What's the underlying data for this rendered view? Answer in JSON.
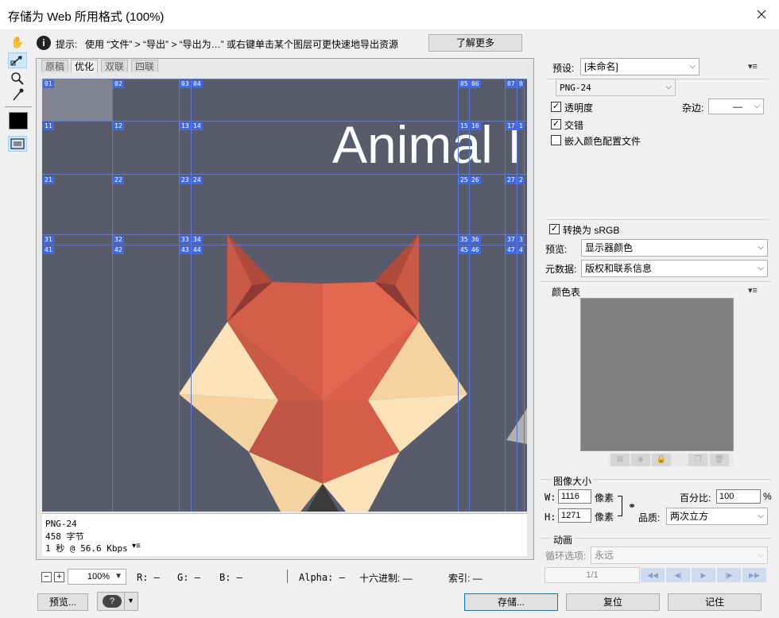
{
  "window": {
    "title": "存储为 Web 所用格式 (100%)",
    "close_icon": "close-icon"
  },
  "tip_bar": {
    "prefix": "提示:",
    "text": "使用 “文件” > “导出” > “导出为…” 或右键单击某个图层可更快速地导出资源",
    "learn_more": "了解更多"
  },
  "tabs": [
    "原稿",
    "优化",
    "双联",
    "四联"
  ],
  "active_tab": "优化",
  "preview": {
    "background": "#585b6a",
    "headline": "Animal I",
    "slice_labels_row1": [
      "01",
      "02",
      "03",
      "04",
      "05",
      "06",
      "07",
      "0"
    ],
    "slice_labels_row2": [
      "11",
      "12",
      "13",
      "14",
      "15",
      "16",
      "17",
      "1"
    ],
    "slice_labels_row3": [
      "21",
      "22",
      "23",
      "24",
      "25",
      "26",
      "27",
      "2"
    ],
    "slice_labels_row4": [
      "31",
      "32",
      "33",
      "34",
      "35",
      "36",
      "37",
      "3"
    ],
    "slice_labels_row5": [
      "41",
      "42",
      "43",
      "44",
      "45",
      "46",
      "47",
      "4"
    ]
  },
  "optim_info": {
    "format": "PNG-24",
    "size": "458 字节",
    "speed": "1 秒 @ 56.6 Kbps"
  },
  "status_bar": {
    "zoom": "100%",
    "r": "R: —",
    "g": "G: —",
    "b": "B: —",
    "alpha": "Alpha: —",
    "hex": "十六进制: —",
    "index": "索引: —"
  },
  "bottom_buttons": {
    "preview": "预览...",
    "save": "存储...",
    "reset": "复位",
    "remember": "记住"
  },
  "settings": {
    "preset_label": "预设:",
    "preset_value": "[未命名]",
    "format_value": "PNG-24",
    "transparency_label": "透明度",
    "transparency_checked": true,
    "matte_label": "杂边:",
    "matte_value": "—",
    "interlaced_label": "交错",
    "interlaced_checked": true,
    "embed_profile_label": "嵌入颜色配置文件",
    "embed_profile_checked": false,
    "convert_srgb_label": "转换为 sRGB",
    "convert_srgb_checked": true,
    "preview_label": "预览:",
    "preview_value": "显示器颜色",
    "metadata_label": "元数据:",
    "metadata_value": "版权和联系信息"
  },
  "color_table": {
    "title": "颜色表",
    "swatch_color": "#808080"
  },
  "image_size": {
    "title": "图像大小",
    "w_label": "W:",
    "w_value": "1116",
    "h_label": "H:",
    "h_value": "1271",
    "unit": "像素",
    "percent_label": "百分比:",
    "percent_value": "100",
    "percent_unit": "%",
    "quality_label": "品质:",
    "quality_value": "两次立方"
  },
  "animation": {
    "title": "动画",
    "loop_label": "循环选项:",
    "loop_value": "永远",
    "frame_counter": "1/1"
  },
  "colors": {
    "accent": "#0078d7",
    "slice_line": "#5b78e8",
    "slice_label_bg": "#4169e1",
    "fox_orange": "#e0634a",
    "fox_cream": "#f5d3a0"
  }
}
